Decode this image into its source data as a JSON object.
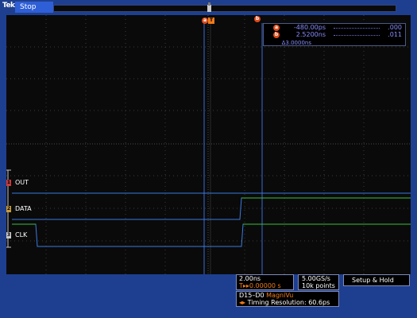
{
  "topbar": {
    "brand": "Tek",
    "run_state": "Stop"
  },
  "cursor_readout": {
    "cursor_a": {
      "label": "a",
      "value": "-480.00ps",
      "end": ".000"
    },
    "cursor_b": {
      "label": "b",
      "value": "2.5200ns",
      "end": ".011"
    },
    "delta": "Δ3.0000ns"
  },
  "cursors": {
    "a": "a",
    "b": "b",
    "trigger": "T"
  },
  "channels": [
    {
      "tag": "1",
      "label": "OUT",
      "color": "#c83a3a"
    },
    {
      "tag": "2",
      "label": "DATA",
      "color": "#c89a3a"
    },
    {
      "tag": "3",
      "label": "CLK",
      "color": "#c8c8c8"
    }
  ],
  "timebase": {
    "time_per_div": "2.00ns",
    "trigger_pos": "0.00000 s",
    "trigger_icon": "T▸▸"
  },
  "acquisition": {
    "sample_rate": "5.00GS/s",
    "record_length": "10k points"
  },
  "trigger_mode": "Setup & Hold",
  "magnivu": {
    "channels": "D15–D0",
    "mode": "MagniVu",
    "resolution_label": "Timing Resolution: 60.6ps",
    "icon": "◂▸"
  },
  "colors": {
    "blue_trace": "#3b7be0",
    "green_trace": "#3cbf3c",
    "accent": "#f07a1a"
  }
}
